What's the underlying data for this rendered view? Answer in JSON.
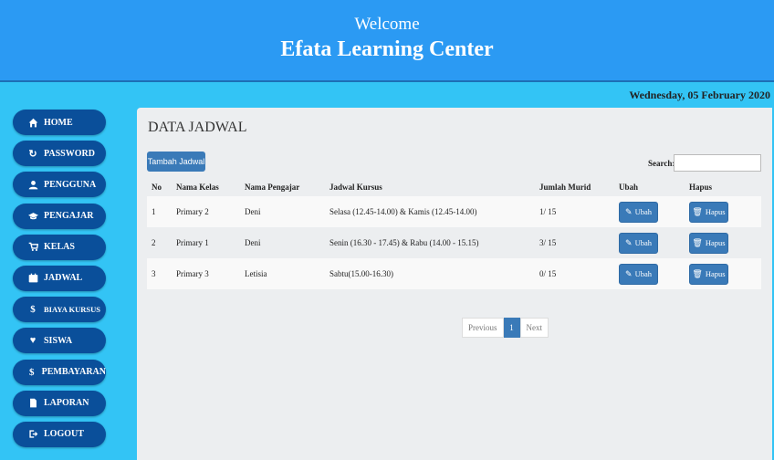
{
  "header": {
    "welcome": "Welcome",
    "title": "Efata Learning Center"
  },
  "date": "Wednesday, 05 February 2020",
  "sidebar": {
    "items": [
      {
        "label": "HOME",
        "icon": "home-icon"
      },
      {
        "label": "PASSWORD",
        "icon": "refresh-icon"
      },
      {
        "label": "PENGGUNA",
        "icon": "user-icon"
      },
      {
        "label": "PENGAJAR",
        "icon": "graduation-cap-icon"
      },
      {
        "label": "KELAS",
        "icon": "cart-icon"
      },
      {
        "label": "JADWAL",
        "icon": "calendar-icon"
      },
      {
        "label": "BIAYA KURSUS",
        "icon": "dollar-icon"
      },
      {
        "label": "SISWA",
        "icon": "heart-icon"
      },
      {
        "label": "PEMBAYARAN",
        "icon": "dollar-icon"
      },
      {
        "label": "LAPORAN",
        "icon": "file-icon"
      },
      {
        "label": "LOGOUT",
        "icon": "logout-icon"
      }
    ]
  },
  "main": {
    "title": "DATA JADWAL",
    "add_button": "Tambah Jadwal",
    "search_label": "Search:",
    "search_value": "",
    "columns": [
      "No",
      "Nama Kelas",
      "Nama Pengajar",
      "Jadwal Kursus",
      "Jumlah Murid",
      "Ubah",
      "Hapus"
    ],
    "rows": [
      {
        "no": "1",
        "kelas": "Primary 2",
        "pengajar": "Deni",
        "jadwal": "Selasa (12.45-14.00) & Kamis (12.45-14.00)",
        "murid": "1/ 15"
      },
      {
        "no": "2",
        "kelas": "Primary 1",
        "pengajar": "Deni",
        "jadwal": "Senin (16.30 - 17.45) & Rabu (14.00 - 15.15)",
        "murid": "3/ 15"
      },
      {
        "no": "3",
        "kelas": "Primary 3",
        "pengajar": "Letisia",
        "jadwal": "Sabtu(15.00-16.30)",
        "murid": "0/ 15"
      }
    ],
    "edit_label": "Ubah",
    "delete_label": "Hapus",
    "pagination": {
      "prev": "Previous",
      "current": "1",
      "next": "Next"
    }
  },
  "colors": {
    "header": "#2b9af3",
    "background": "#33c4f5",
    "nav": "#0a4f9a",
    "button": "#3a7ab8"
  }
}
